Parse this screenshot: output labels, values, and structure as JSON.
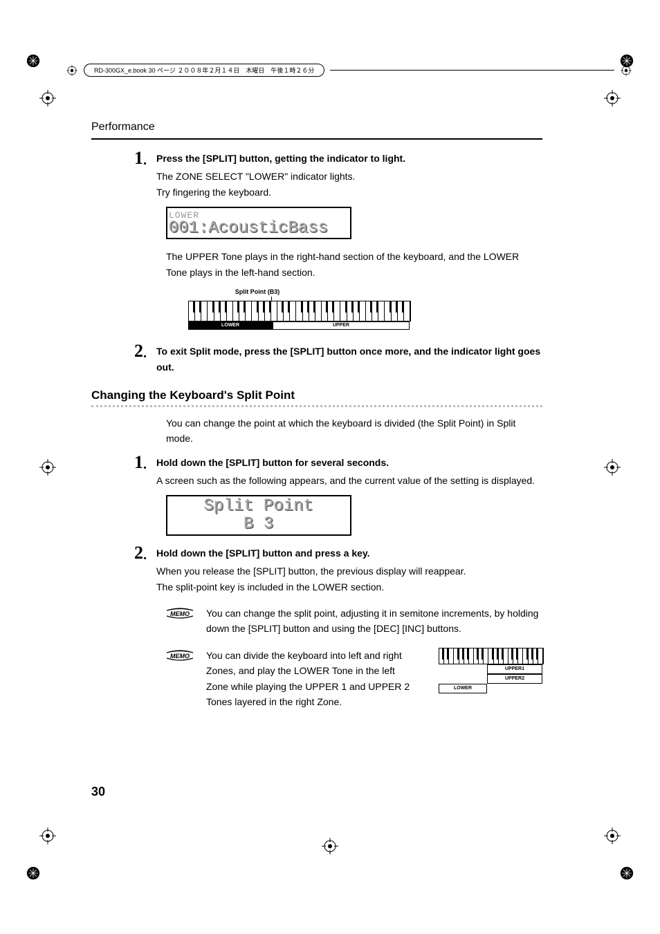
{
  "header": {
    "text": "RD-300GX_e.book  30 ページ  ２００８年２月１４日　木曜日　午後１時２６分"
  },
  "section": "Performance",
  "step1": {
    "num": "1",
    "lead": "Press the [SPLIT] button, getting the indicator to light.",
    "line1": "The ZONE SELECT \"LOWER\" indicator lights.",
    "line2": "Try fingering the keyboard.",
    "lcd_top": "LOWER",
    "lcd_main": "001:AcousticBass",
    "after": "The UPPER Tone plays in the right-hand section of the keyboard, and the LOWER Tone plays in the left-hand section.",
    "split_label": "Split Point (B3)",
    "zone_lower": "LOWER",
    "zone_upper": "UPPER"
  },
  "step2": {
    "num": "2",
    "lead": "To exit Split mode, press the [SPLIT] button once more, and the indicator light goes out."
  },
  "subhead": "Changing the Keyboard's Split Point",
  "sub_intro": "You can change the point at which the keyboard is divided (the Split Point) in Split mode.",
  "sub_step1": {
    "num": "1",
    "lead": "Hold down the [SPLIT] button for several seconds.",
    "after": "A screen such as the following appears, and the current value of the setting is displayed.",
    "lcd_top": "Split Point",
    "lcd_main": "B 3"
  },
  "sub_step2": {
    "num": "2",
    "lead": "Hold down the [SPLIT] button and press a key.",
    "line1": "When you release the [SPLIT] button, the previous display will reappear.",
    "line2": "The split-point key is included in the LOWER section."
  },
  "memo1": "You can change the split point, adjusting it in semitone increments, by holding down the [SPLIT] button and using the [DEC] [INC] buttons.",
  "memo2": "You can divide the keyboard into left and right Zones, and play the LOWER Tone in the left Zone while playing the UPPER 1 and UPPER 2 Tones layered in the right Zone.",
  "zones_small": {
    "lower": "LOWER",
    "upper1": "UPPER1",
    "upper2": "UPPER2"
  },
  "page_number": "30"
}
